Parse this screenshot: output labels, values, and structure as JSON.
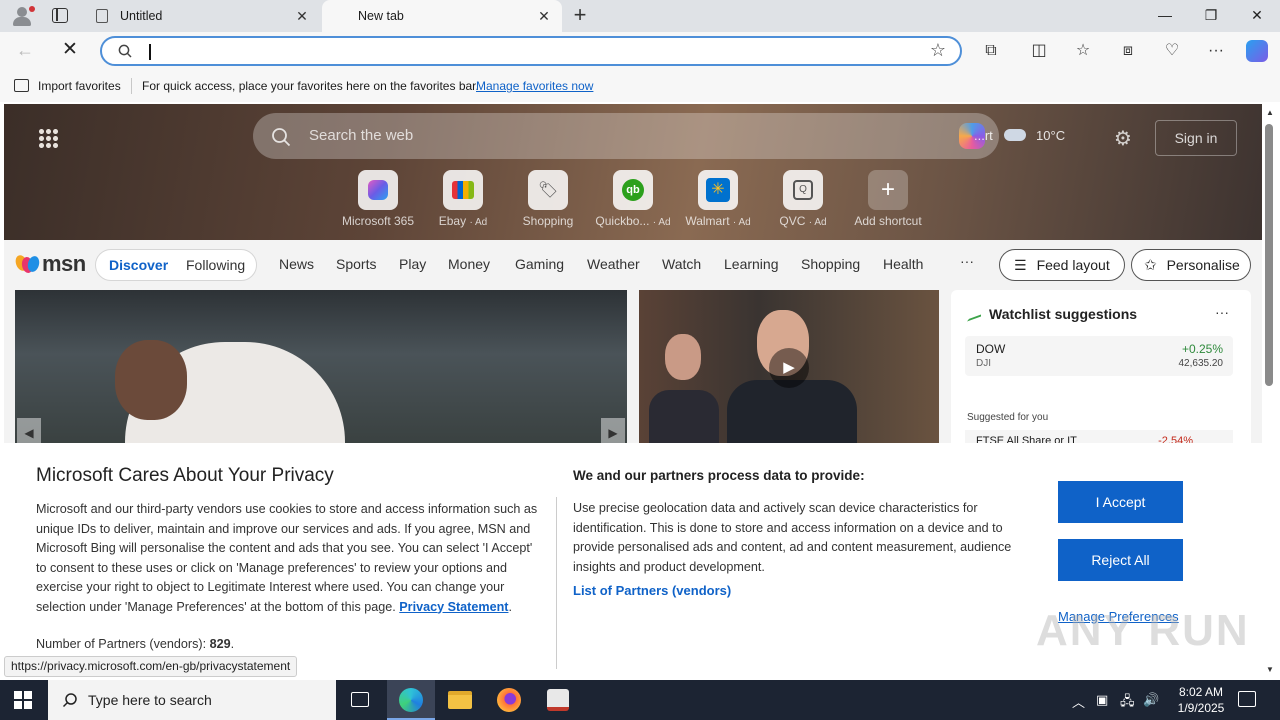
{
  "browser": {
    "tabs": [
      {
        "label": "Untitled",
        "active": false
      },
      {
        "label": "New tab",
        "active": true
      }
    ],
    "address_bar": {
      "value": "",
      "placeholder": ""
    },
    "favorites_bar": {
      "import_label": "Import favorites",
      "message": "For quick access, place your favorites here on the favorites bar.",
      "link": "Manage favorites now"
    },
    "status_url": "https://privacy.microsoft.com/en-gb/privacystatement"
  },
  "newtab": {
    "search_placeholder": "Search the web",
    "weather": {
      "location": "...rt",
      "temperature": "10",
      "unit": "°C"
    },
    "sign_in": "Sign in",
    "shortcuts": [
      {
        "label": "Microsoft 365",
        "ad": "",
        "icon": "microsoft-365-icon"
      },
      {
        "label": "Ebay",
        "ad": "· Ad",
        "icon": "ebay-icon"
      },
      {
        "label": "Shopping",
        "ad": "",
        "icon": "shopping-tag-icon"
      },
      {
        "label": "Quickbo...",
        "ad": "· Ad",
        "icon": "quickbooks-icon"
      },
      {
        "label": "Walmart",
        "ad": "· Ad",
        "icon": "walmart-icon"
      },
      {
        "label": "QVC",
        "ad": "· Ad",
        "icon": "qvc-icon"
      },
      {
        "label": "Add shortcut",
        "ad": "",
        "icon": "plus-icon"
      }
    ],
    "brand": "msn",
    "pill_nav": {
      "discover": "Discover",
      "following": "Following"
    },
    "nav_items": [
      "News",
      "Sports",
      "Play",
      "Money",
      "Gaming",
      "Weather",
      "Watch",
      "Learning",
      "Shopping",
      "Health"
    ],
    "more": "···",
    "feed_layout": "Feed layout",
    "personalise": "Personalise",
    "watchlist": {
      "title": "Watchlist suggestions",
      "items": [
        {
          "symbol": "DOW",
          "sub": "DJI",
          "change": "+0.25%",
          "value": "42,635.20"
        }
      ],
      "suggested_label": "Suggested for you",
      "suggested_items": [
        {
          "symbol": "FTSE All Share or IT",
          "change": "-2.54%"
        }
      ]
    }
  },
  "consent": {
    "title": "Microsoft Cares About Your Privacy",
    "body": "Microsoft and our third-party vendors use cookies to store and access information such as unique IDs to deliver, maintain and improve our services and ads. If you agree, MSN and Microsoft Bing will personalise the content and ads that you see. You can select 'I Accept' to consent to these uses or click on 'Manage preferences' to review your options and exercise your right to object to Legitimate Interest where used. You can change your selection under 'Manage Preferences' at the bottom of this page.",
    "privacy_link": "Privacy Statement",
    "partners_label": "Number of Partners (vendors):",
    "partners_count": "829",
    "right_title": "We and our partners process data to provide:",
    "right_body": "Use precise geolocation data and actively scan device characteristics for identification. This is done to store and access information on a device and to provide personalised ads and content, ad and content measurement, audience insights and product development.",
    "list_partners": "List of Partners (vendors)",
    "accept": "I Accept",
    "reject": "Reject All",
    "manage": "Manage Preferences"
  },
  "taskbar": {
    "search_placeholder": "Type here to search",
    "time": "8:02 AM",
    "date": "1/9/2025"
  },
  "watermark": "ANY RUN"
}
